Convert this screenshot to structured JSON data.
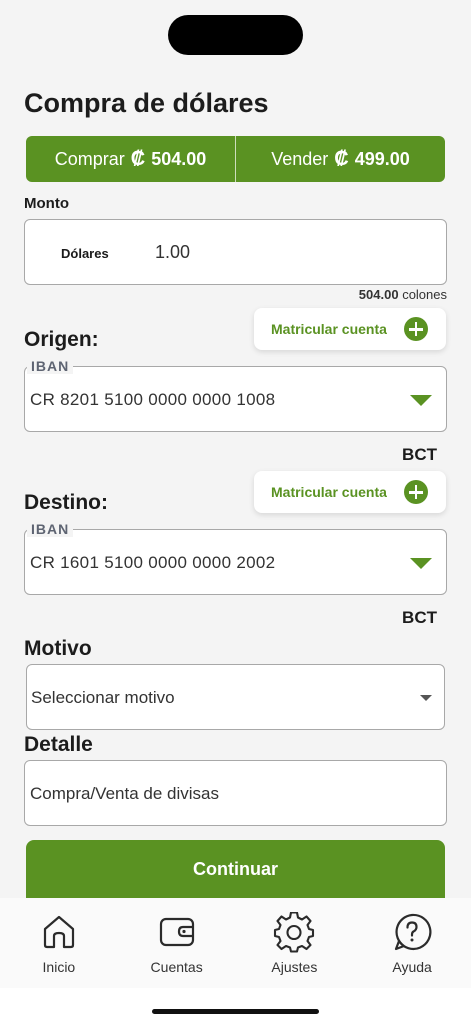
{
  "page": {
    "title": "Compra de dólares"
  },
  "rates": {
    "buy": {
      "label": "Comprar",
      "symbol": "₡",
      "value": "504.00"
    },
    "sell": {
      "label": "Vender",
      "symbol": "₡",
      "value": "499.00"
    },
    "accent": "#5a9222"
  },
  "amount": {
    "label": "Monto",
    "currency_label": "Dólares",
    "value": "1.00",
    "converted_value": "504.00",
    "converted_unit": "colones"
  },
  "origin": {
    "heading": "Origen:",
    "enroll_label": "Matricular cuenta",
    "field_tag": "IBAN",
    "value": "CR 8201 5100 0000 0000 1008",
    "bank": "BCT"
  },
  "destination": {
    "heading": "Destino:",
    "enroll_label": "Matricular cuenta",
    "field_tag": "IBAN",
    "value": "CR 1601 5100 0000 0000 2002",
    "bank": "BCT"
  },
  "reason": {
    "heading": "Motivo",
    "placeholder": "Seleccionar motivo"
  },
  "detail": {
    "heading": "Detalle",
    "value": "Compra/Venta de divisas"
  },
  "actions": {
    "continue_label": "Continuar"
  },
  "tabbar": {
    "items": [
      {
        "label": "Inicio",
        "icon": "home-icon"
      },
      {
        "label": "Cuentas",
        "icon": "wallet-icon"
      },
      {
        "label": "Ajustes",
        "icon": "gear-icon"
      },
      {
        "label": "Ayuda",
        "icon": "help-icon"
      }
    ]
  }
}
